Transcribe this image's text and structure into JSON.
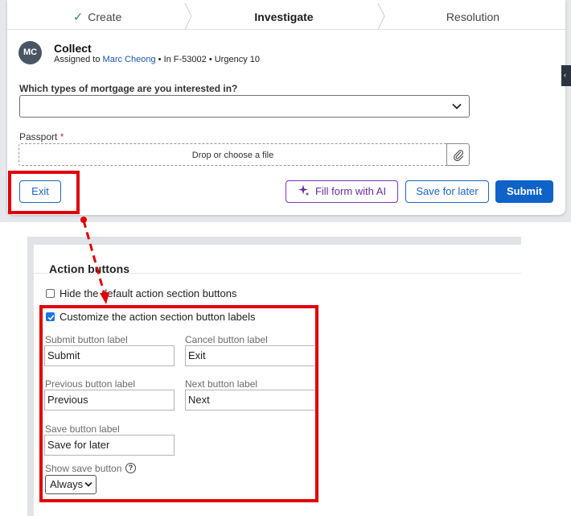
{
  "stepper": {
    "steps": [
      {
        "label": "Create",
        "state": "done"
      },
      {
        "label": "Investigate",
        "state": "current"
      },
      {
        "label": "Resolution",
        "state": "upcoming"
      }
    ]
  },
  "case": {
    "avatar_initials": "MC",
    "title": "Collect",
    "assigned_prefix": "Assigned to",
    "assignee": "Marc Cheong",
    "meta_suffix": "• In F-53002 • Urgency 10"
  },
  "form": {
    "mortgage_label": "Which types of mortgage are you interested in?",
    "mortgage_value": "",
    "passport_label": "Passport",
    "required_mark": "*",
    "dropzone_text": "Drop or choose a file"
  },
  "actions": {
    "exit_label": "Exit",
    "ai_label": "Fill form with AI",
    "save_label": "Save for later",
    "submit_label": "Submit"
  },
  "settings": {
    "section_title": "Action buttons",
    "hide_default": {
      "label": "Hide the default action section buttons",
      "checked": false
    },
    "customize": {
      "label": "Customize the action section button labels",
      "checked": true
    },
    "submit_label_caption": "Submit button label",
    "submit_value": "Submit",
    "cancel_label_caption": "Cancel button label",
    "cancel_value": "Exit",
    "previous_label_caption": "Previous button label",
    "previous_value": "Previous",
    "next_label_caption": "Next button label",
    "next_value": "Next",
    "save_label_caption": "Save button label",
    "save_value": "Save for later",
    "show_save_caption": "Show save button",
    "show_save_value": "Always"
  },
  "colors": {
    "primary": "#0f62c8",
    "ai_purple": "#7a35b6",
    "highlight_red": "#e00000",
    "done_green": "#2e8b57"
  }
}
